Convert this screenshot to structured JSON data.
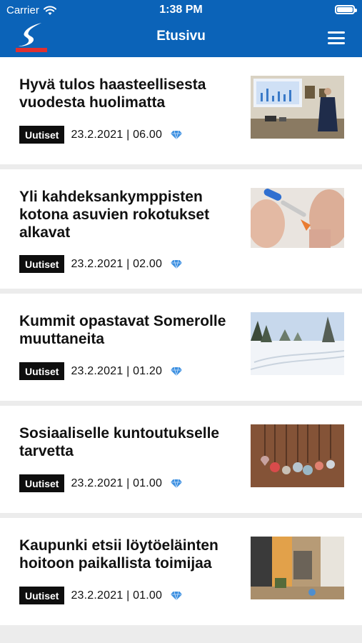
{
  "status": {
    "carrier": "Carrier",
    "time": "1:38 PM"
  },
  "header": {
    "title": "Etusivu"
  },
  "articles": [
    {
      "title": "Hyvä tulos haasteellisesta vuodesta huolimatta",
      "category": "Uutiset",
      "datetime": "23.2.2021 | 06.00"
    },
    {
      "title": "Yli kahdeksankymppisten kotona asuvien rokotukset alkavat",
      "category": "Uutiset",
      "datetime": "23.2.2021 | 02.00"
    },
    {
      "title": "Kummit opastavat Somerolle muuttaneita",
      "category": "Uutiset",
      "datetime": "23.2.2021 | 01.20"
    },
    {
      "title": "Sosiaaliselle kuntoutukselle tarvetta",
      "category": "Uutiset",
      "datetime": "23.2.2021 | 01.00"
    },
    {
      "title": "Kaupunki etsii löytöeläinten hoitoon paikallista toimijaa",
      "category": "Uutiset",
      "datetime": "23.2.2021 | 01.00"
    }
  ],
  "colors": {
    "header_bg": "#0b63b8",
    "badge_bg": "#0e0e0e",
    "premium_icon": "#3b8fe0",
    "logo_accent": "#e03030"
  },
  "icons": {
    "premium": "diamond-icon",
    "menu": "hamburger-icon",
    "wifi": "wifi-icon",
    "battery": "battery-icon"
  }
}
